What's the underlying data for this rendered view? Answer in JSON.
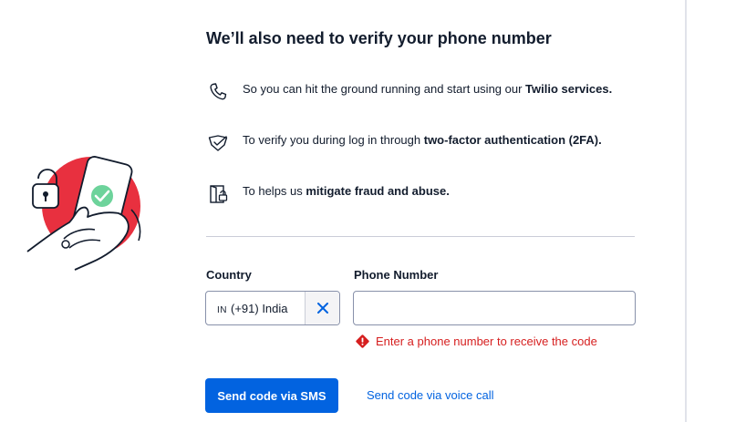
{
  "title": "We’ll also need to verify your phone number",
  "benefits": [
    {
      "icon": "phone-icon",
      "text": "So you can hit the ground running and start using our ",
      "bold": "Twilio services.",
      "after": ""
    },
    {
      "icon": "shield-check-icon",
      "text": "To verify you during log in through ",
      "bold": "two-factor authentication (2FA).",
      "after": ""
    },
    {
      "icon": "lock-door-icon",
      "text": "To helps us ",
      "bold": "mitigate fraud and abuse.",
      "after": ""
    }
  ],
  "form": {
    "country_label": "Country",
    "country_code": "IN",
    "country_value": "(+91) India",
    "phone_label": "Phone Number",
    "phone_value": "",
    "error": "Enter a phone number to receive the code"
  },
  "actions": {
    "sms_button": "Send code via SMS",
    "voice_link": "Send code via voice call"
  },
  "colors": {
    "brand_blue": "#0263e0",
    "error_red": "#d61f1f",
    "illustration_red": "#e8303f",
    "check_green": "#6dd39b"
  }
}
